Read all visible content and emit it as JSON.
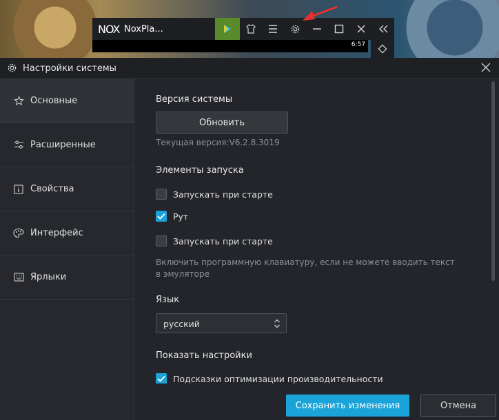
{
  "nox": {
    "logo": "NOX",
    "title": "NoxPla...",
    "status_time": "6:57",
    "buttons": [
      "play-store-icon",
      "shirt-icon",
      "menu-icon",
      "gear-icon",
      "minimize-icon",
      "maximize-icon",
      "close-icon",
      "collapse-icon"
    ]
  },
  "dialog": {
    "title": "Настройки системы"
  },
  "sidebar": {
    "items": [
      {
        "label": "Основные",
        "icon": "star-icon"
      },
      {
        "label": "Расширенные",
        "icon": "sliders-icon"
      },
      {
        "label": "Свойства",
        "icon": "info-icon"
      },
      {
        "label": "Интерфейс",
        "icon": "palette-icon"
      },
      {
        "label": "Ярлыки",
        "icon": "keyboard-icon"
      }
    ]
  },
  "content": {
    "system_version": {
      "title": "Версия системы",
      "update_label": "Обновить",
      "current_version": "Текущая версия:V6.2.8.3019"
    },
    "launch": {
      "title": "Элементы запуска",
      "options": [
        {
          "label": "Запускать при старте",
          "checked": false
        },
        {
          "label": "Рут",
          "checked": true
        },
        {
          "label": "Запускать при старте",
          "checked": false
        }
      ],
      "hint": "Включить программную клавиатуру, если не можете вводить текст в эмуляторе"
    },
    "language": {
      "title": "Язык",
      "selected": "русский"
    },
    "display": {
      "title": "Показать настройки",
      "options": [
        {
          "label": "Подсказки оптимизации производительности",
          "checked": true
        }
      ]
    }
  },
  "footer": {
    "save_label": "Сохранить изменения",
    "cancel_label": "Отмена"
  },
  "colors": {
    "accent": "#1aa3d8",
    "dialog_bg": "#23252a",
    "arrow": "#e53030"
  }
}
